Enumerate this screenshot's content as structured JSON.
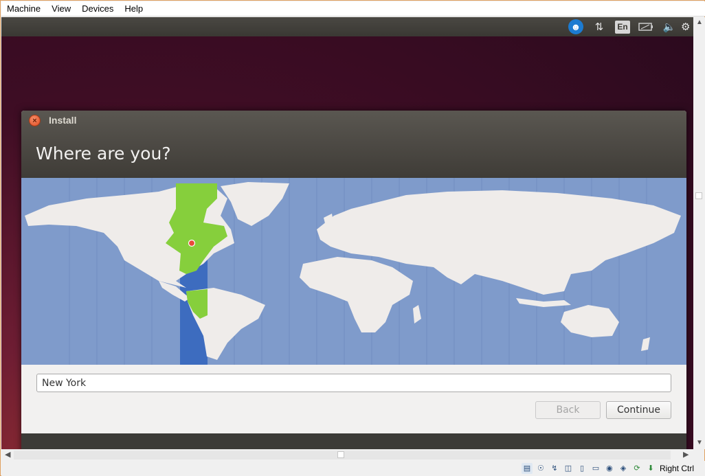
{
  "host_menu": [
    "Machine",
    "View",
    "Devices",
    "Help"
  ],
  "guest_panel": {
    "icons": [
      "accessibility-icon",
      "network-icon",
      "keyboard-layout-indicator",
      "battery-icon",
      "volume-icon",
      "settings-gear-icon"
    ],
    "keyboard_layout": "En"
  },
  "installer": {
    "window_title": "Install",
    "heading": "Where are you?",
    "location_value": "New York",
    "back_label": "Back",
    "continue_label": "Continue",
    "back_enabled": false,
    "selected_city": "New York"
  },
  "status_bar": {
    "icons": [
      "hard-disk-icon",
      "optical-drive-icon",
      "usb-icon",
      "network-adapter-icon",
      "shared-folders-icon",
      "display-icon",
      "video-capture-icon",
      "virtualization-icon",
      "mouse-integration-icon",
      "keyboard-capture-icon"
    ],
    "host_key": "Right Ctrl"
  },
  "colors": {
    "ocean": "#7f9bcb",
    "land": "#efecea",
    "selected_timezone_land": "#86cf3c",
    "selected_timezone_band": "#3d6cbf",
    "accent": "#df4a20"
  }
}
